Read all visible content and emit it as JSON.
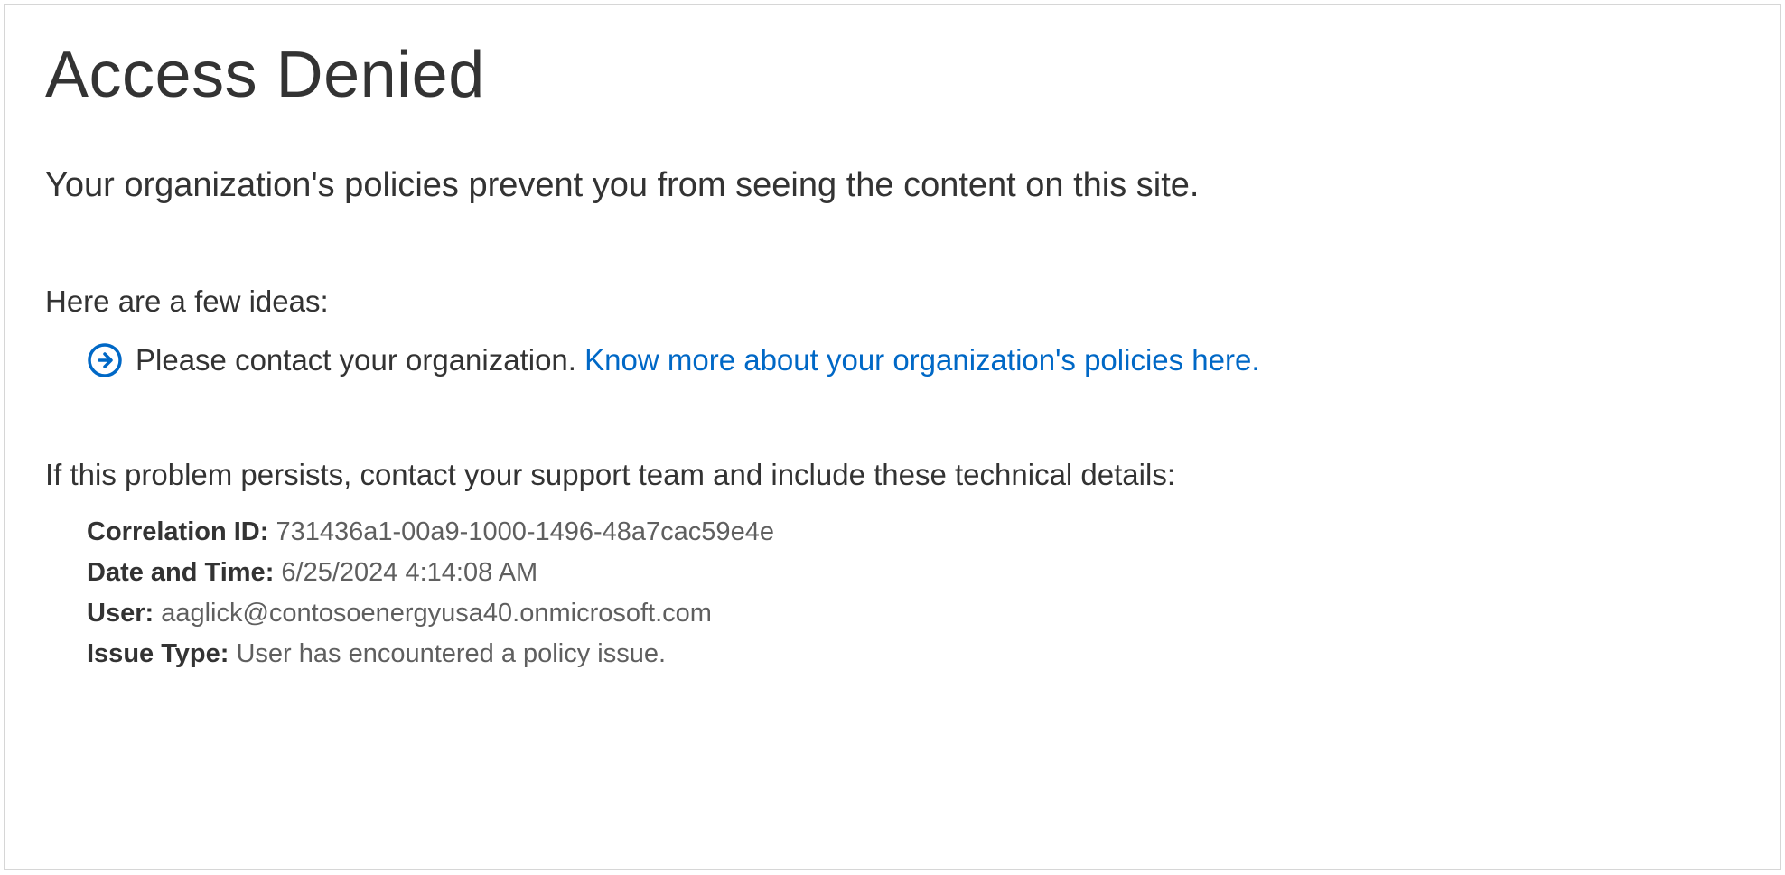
{
  "title": "Access Denied",
  "message": "Your organization's policies prevent you from seeing the content on this site.",
  "ideas_label": "Here are a few ideas:",
  "idea": {
    "text": "Please contact your organization. ",
    "link_text": "Know more about your organization's policies here."
  },
  "support_label": "If this problem persists, contact your support team and include these technical details:",
  "tech": {
    "correlation_label": "Correlation ID: ",
    "correlation_value": "731436a1-00a9-1000-1496-48a7cac59e4e",
    "datetime_label": "Date and Time: ",
    "datetime_value": "6/25/2024 4:14:08 AM",
    "user_label": "User: ",
    "user_value": "aaglick@contosoenergyusa40.onmicrosoft.com",
    "issue_label": "Issue Type: ",
    "issue_value": "User has encountered a policy issue."
  }
}
